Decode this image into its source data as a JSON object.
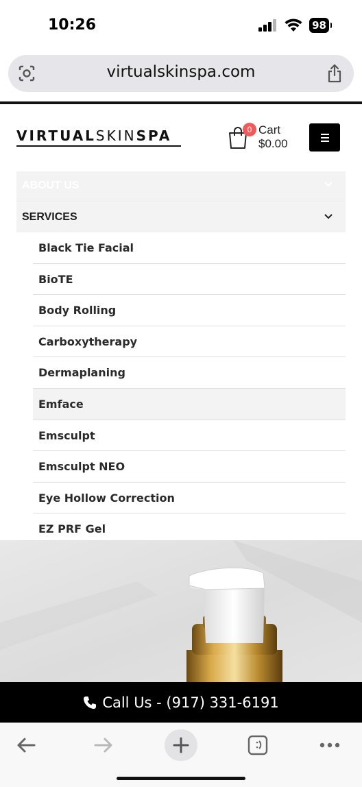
{
  "status_bar": {
    "time": "10:26",
    "battery": "98",
    "icons": [
      "cellular-signal-icon",
      "wifi-icon",
      "battery-icon"
    ]
  },
  "browser": {
    "url": "virtualskinspa.com",
    "left_icon": "page-menu-icon",
    "right_icon": "share-icon"
  },
  "header": {
    "logo_text_a": "VIRTUAL",
    "logo_text_b": "SKIN",
    "logo_text_c": "SPA",
    "cart_badge": "0",
    "cart_label": "Cart",
    "cart_total": "$0.00"
  },
  "menu": {
    "top_item": "ABOUT US",
    "services_label": "SERVICES",
    "services_items": [
      "Black Tie Facial",
      "BioTE",
      "Body Rolling",
      "Carboxytherapy",
      "Dermaplaning",
      "Emface",
      "Emsculpt",
      "Emsculpt NEO",
      "Eye Hollow Correction",
      "EZ PRF Gel"
    ]
  },
  "call_bar": {
    "text": "Call Us - (917) 331-6191"
  },
  "toolbar": {
    "icons": [
      "back-arrow-icon",
      "forward-arrow-icon",
      "new-tab-plus-icon",
      "tabs-icon",
      "more-icon"
    ]
  },
  "colors": {
    "accent_black": "#000000",
    "badge_red": "#f05a5a",
    "menu_bg": "#f3f3f3"
  }
}
